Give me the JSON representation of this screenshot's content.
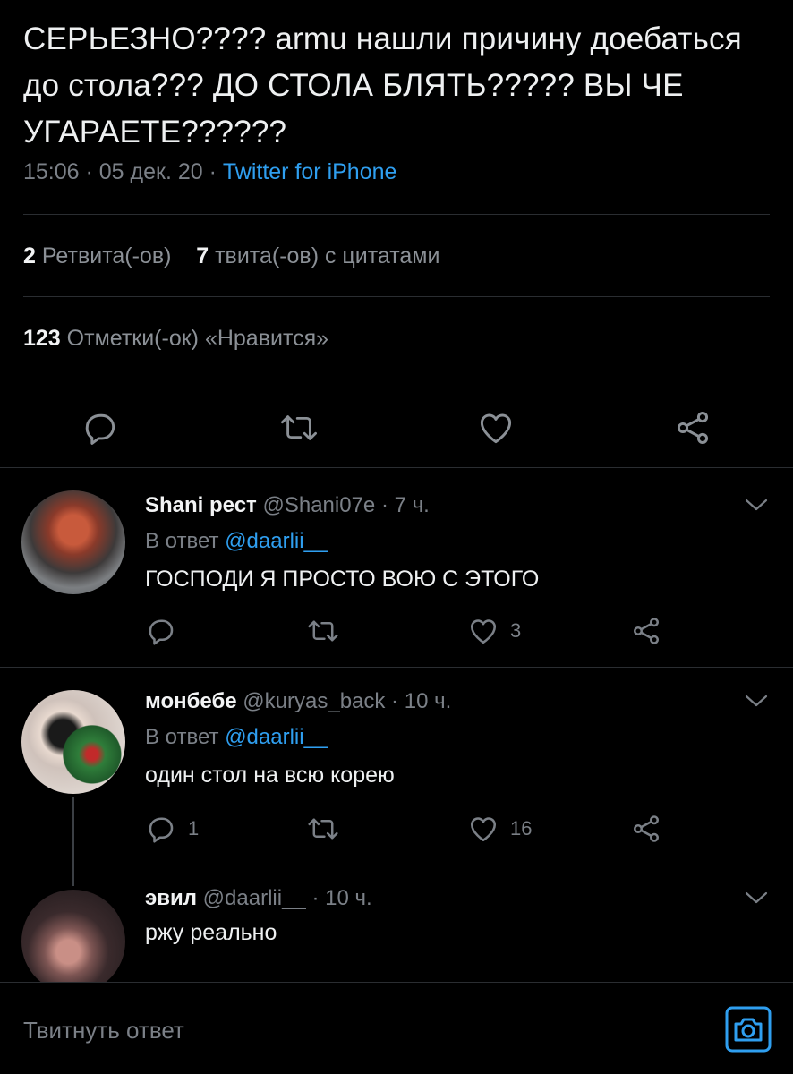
{
  "tweet": {
    "text": "СЕРЬЕЗНО???? armu нашли причину доебаться до стола??? ДО СТОЛА БЛЯТЬ????? ВЫ ЧЕ УГАРАЕТЕ??????",
    "time": "15:06 · 05 дек. 20 · ",
    "source": "Twitter for iPhone"
  },
  "stats": {
    "retweets_count": "2",
    "retweets_label": "Ретвита(-ов)",
    "quotes_count": "7",
    "quotes_label": "твита(-ов) с цитатами",
    "likes_count": "123",
    "likes_label": "Отметки(-ок) «Нравится»"
  },
  "replies": [
    {
      "name": "Shani рест",
      "meta": " @Shani07e · 7 ч.",
      "reply_prefix": "В ответ ",
      "reply_to": "@daarlii__",
      "text": "ГОСПОДИ Я ПРОСТО ВОЮ С ЭТОГО",
      "reply_count": "",
      "retweet_count": "",
      "like_count": "3"
    },
    {
      "name": "монбебе",
      "meta": " @kuryas_back · 10 ч.",
      "reply_prefix": "В ответ ",
      "reply_to": "@daarlii__",
      "text": "один стол на всю корею",
      "reply_count": "1",
      "retweet_count": "",
      "like_count": "16"
    },
    {
      "name": "эвил",
      "meta": " @daarlii__ · 10 ч.",
      "text": "ржу реально"
    }
  ],
  "compose": {
    "placeholder": "Твитнуть ответ"
  },
  "colors": {
    "background": "#000000",
    "text": "#eef0f1",
    "secondary": "#7b8087",
    "accent": "#2f9ff0",
    "divider": "#2a2d31"
  },
  "icons": [
    "reply-icon",
    "retweet-icon",
    "like-icon",
    "share-icon",
    "chevron-down-icon",
    "camera-icon"
  ]
}
